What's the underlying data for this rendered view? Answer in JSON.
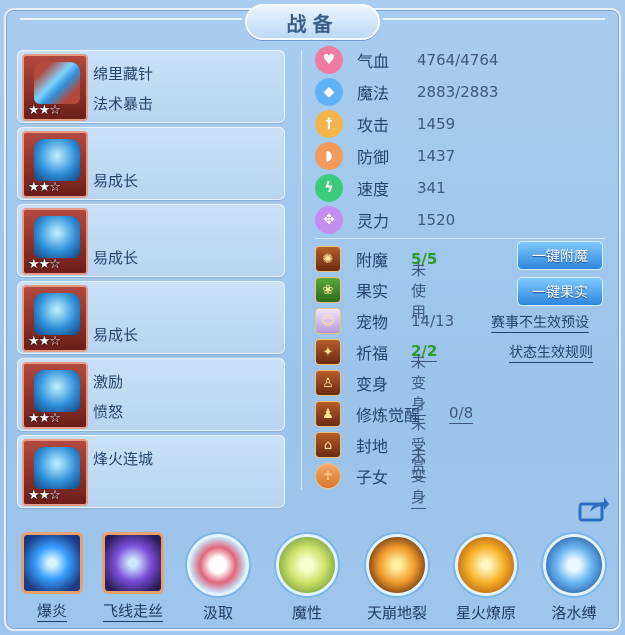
{
  "title": "战备",
  "equipment": [
    {
      "name": "绵里藏针",
      "effect": "法术暴击",
      "stars": "★★☆"
    },
    {
      "name": "",
      "effect": "易成长",
      "stars": "★★☆"
    },
    {
      "name": "",
      "effect": "易成长",
      "stars": "★★☆"
    },
    {
      "name": "",
      "effect": "易成长",
      "stars": "★★☆"
    },
    {
      "name": "激励",
      "effect": "愤怒",
      "stars": "★★☆"
    },
    {
      "name": "烽火连城",
      "effect": "",
      "stars": "★★☆"
    }
  ],
  "stats": [
    {
      "icon": "heart-icon",
      "label": "气血",
      "value": "4764/4764",
      "color": "#f07aa0"
    },
    {
      "icon": "mana-icon",
      "label": "魔法",
      "value": "2883/2883",
      "color": "#5fb2f5"
    },
    {
      "icon": "sword-icon",
      "label": "攻击",
      "value": "1459",
      "color": "#f3b54a"
    },
    {
      "icon": "shield-icon",
      "label": "防御",
      "value": "1437",
      "color": "#f29a5a"
    },
    {
      "icon": "speed-icon",
      "label": "速度",
      "value": "341",
      "color": "#3ccb7a"
    },
    {
      "icon": "spirit-icon",
      "label": "灵力",
      "value": "1520",
      "color": "#c58df0"
    }
  ],
  "details": [
    {
      "icon": "enchant-icon",
      "label": "附魔",
      "value": "5/5"
    },
    {
      "icon": "fruit-icon",
      "label": "果实",
      "value": "未使用"
    },
    {
      "icon": "pet-icon",
      "label": "宠物",
      "value": "14/13"
    },
    {
      "icon": "blessing-icon",
      "label": "祈福",
      "value": "2/2"
    },
    {
      "icon": "transform-icon",
      "label": "变身",
      "value": "未变身"
    },
    {
      "icon": "cultivation-icon",
      "label": "修炼觉醒",
      "value": "0/8"
    },
    {
      "icon": "territory-icon",
      "label": "封地",
      "value": "未受赏"
    },
    {
      "icon": "child-icon",
      "label": "子女",
      "value": "未变身"
    }
  ],
  "buttons": {
    "enchant_all": "一键附魔",
    "fruit_all": "一键果实"
  },
  "links": {
    "event_preset": "赛事不生效预设",
    "status_rules": "状态生效规则"
  },
  "skills": [
    {
      "label": "爆炎",
      "style": "square",
      "color": "#3aa0ff"
    },
    {
      "label": "飞线走丝",
      "style": "square",
      "color": "#7a4fd8"
    },
    {
      "label": "汲取",
      "style": "ring",
      "color": "#e0647a"
    },
    {
      "label": "魔性",
      "style": "ring",
      "color": "#cfe26a"
    },
    {
      "label": "天崩地裂",
      "style": "ring",
      "color": "#f09a2a"
    },
    {
      "label": "星火燎原",
      "style": "ring",
      "color": "#f6b22a"
    },
    {
      "label": "洛水缚",
      "style": "ring",
      "color": "#69b6f2"
    }
  ]
}
